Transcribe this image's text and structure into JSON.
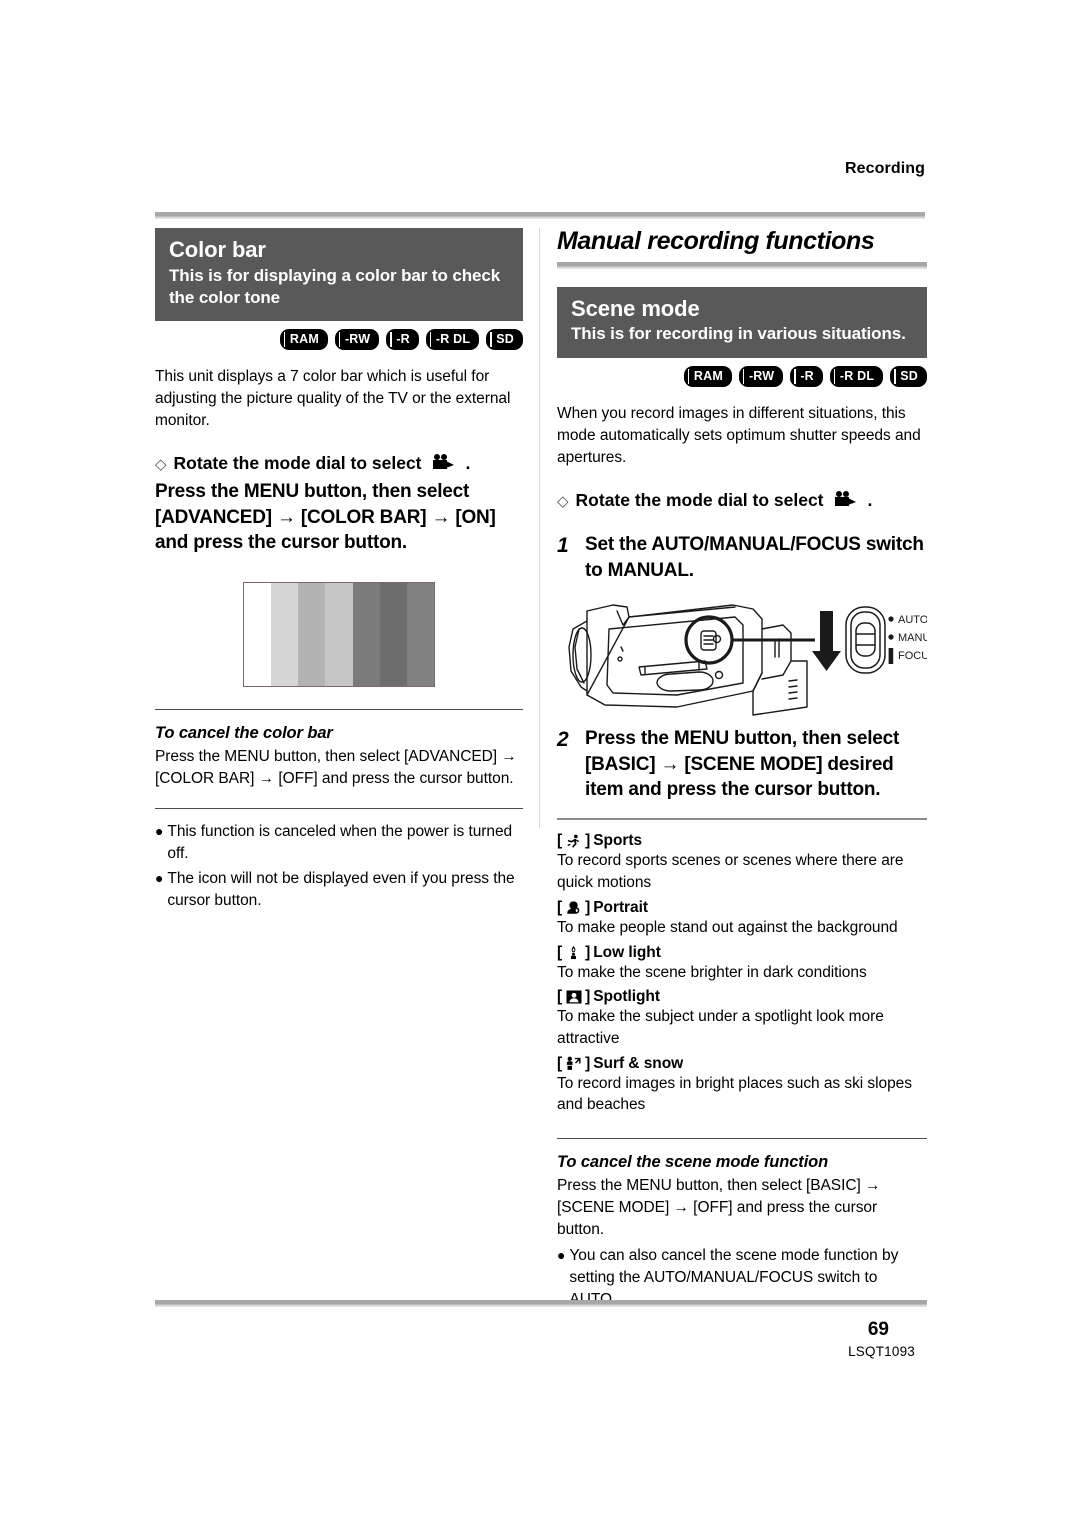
{
  "header": {
    "section_label": "Recording"
  },
  "left_column": {
    "banner": {
      "title": "Color bar",
      "subtitle": "This is for displaying a color bar to check the color tone"
    },
    "badges": [
      "RAM",
      "-RW",
      "-R",
      "-R DL",
      "SD"
    ],
    "intro": "This unit displays a 7 color bar which is useful for adjusting the picture quality of the TV or the external monitor.",
    "diamond_step": {
      "marker": "◇",
      "text_before": "Rotate the mode dial to select",
      "icon": "camcorder-icon",
      "text_after": "."
    },
    "instruction_bold": "Press the MENU button, then select [ADVANCED] → [COLOR BAR] → [ON] and press the cursor button.",
    "colorbar_figure": {
      "name": "color-bar-figure",
      "bars": [
        "#ffffff",
        "#d5d5d5",
        "#b3b3b3",
        "#c6c6c6",
        "#7b7b7b",
        "#6d6d6d",
        "#818181"
      ]
    },
    "cancel_section": {
      "heading": "To cancel the color bar",
      "body": "Press the MENU button, then select [ADVANCED] → [COLOR BAR] → [OFF] and press the cursor button."
    },
    "notes": [
      "This function is canceled when the power is turned off.",
      "The icon will not be displayed even if you press the cursor button."
    ]
  },
  "right_column": {
    "chapter_title": "Manual recording functions",
    "banner": {
      "title": "Scene mode",
      "subtitle": "This is for recording in various situations."
    },
    "badges": [
      "RAM",
      "-RW",
      "-R",
      "-R DL",
      "SD"
    ],
    "intro": "When you record images in different situations, this mode automatically sets optimum shutter speeds and apertures.",
    "diamond_step": {
      "marker": "◇",
      "text_before": "Rotate the mode dial to select",
      "icon": "camcorder-icon",
      "text_after": "."
    },
    "steps": [
      {
        "number": "1",
        "text": "Set the AUTO/MANUAL/FOCUS switch to MANUAL."
      },
      {
        "number": "2",
        "text": "Press the MENU button, then select [BASIC] → [SCENE MODE] desired item and press the cursor button."
      }
    ],
    "camcorder_figure": {
      "name": "camcorder-illustration",
      "switch_labels": [
        "AUTO",
        "MANUAL",
        "FOCUS"
      ]
    },
    "scene_modes": [
      {
        "icon": "sports-runner-icon",
        "label": "Sports",
        "description": "To record sports scenes or scenes where there are quick motions"
      },
      {
        "icon": "portrait-person-icon",
        "label": "Portrait",
        "description": "To make people stand out against the background"
      },
      {
        "icon": "low-light-candle-icon",
        "label": "Low light",
        "description": "To make the scene brighter in dark conditions"
      },
      {
        "icon": "spotlight-icon",
        "label": "Spotlight",
        "description": "To make the subject under a spotlight look more attractive"
      },
      {
        "icon": "surf-snow-icon",
        "label": "Surf & snow",
        "description": "To record images in bright places such as ski slopes and beaches"
      }
    ],
    "cancel_section": {
      "heading": "To cancel the scene mode function",
      "body": "Press the MENU button, then select [BASIC] → [SCENE MODE] → [OFF] and press the cursor button."
    },
    "notes": [
      "You can also cancel the scene mode function by setting the AUTO/MANUAL/FOCUS switch to AUTO."
    ]
  },
  "footer": {
    "page_number": "69",
    "document_code": "LSQT1093"
  },
  "colors": {
    "banner_bg": "#595959",
    "rule_gray": "#a7a7a7",
    "badge_bg": "#000000"
  }
}
